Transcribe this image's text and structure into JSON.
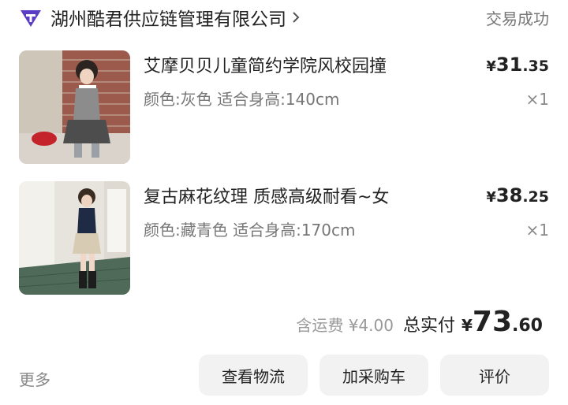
{
  "header": {
    "store_icon": "store-logo-icon",
    "store_name": "湖州酷君供应链管理有限公司",
    "chevron_icon": "chevron-right-icon",
    "status": "交易成功"
  },
  "products": [
    {
      "image": "product-photo-girl-gray-vest-skirt",
      "title": "艾摩贝贝儿童简约学院风校园撞",
      "spec": "颜色:灰色 适合身高:140cm",
      "price_yen": "¥",
      "price_int": "31",
      "price_dec": ".35",
      "qty": "×1"
    },
    {
      "image": "product-photo-girl-navy-knit-skirt",
      "title": "复古麻花纹理 质感高级耐看~女",
      "spec": "颜色:藏青色 适合身高:170cm",
      "price_yen": "¥",
      "price_int": "38",
      "price_dec": ".25",
      "qty": "×1"
    }
  ],
  "summary": {
    "shipping": "含运费 ¥4.00",
    "total_label": "总实付",
    "total_yen": "¥",
    "total_int": "73",
    "total_dec": ".60"
  },
  "footer": {
    "more": "更多",
    "logistics_button": "查看物流",
    "cart_button": "加采购车",
    "review_button": "评价"
  },
  "colors": {
    "logo_purple": "#5b3cc4",
    "button_bg": "#f2f2f2",
    "muted_text": "#777777"
  }
}
